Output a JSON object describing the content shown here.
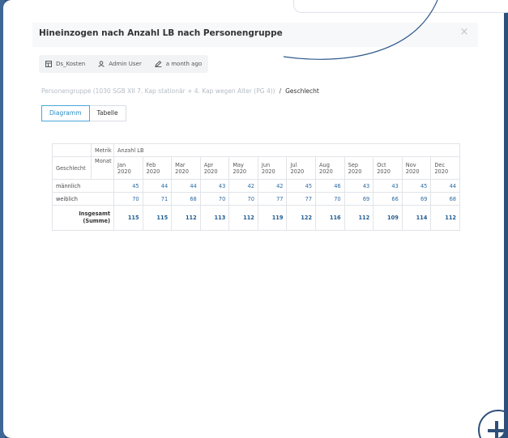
{
  "dialog": {
    "title": "Hineinzogen nach Anzahl LB nach Personengruppe",
    "close_glyph": "×"
  },
  "meta": {
    "dataset": "Ds_Kosten",
    "author": "Admin User",
    "modified": "a month ago",
    "icons": [
      "table-icon",
      "user-icon",
      "pencil-icon"
    ]
  },
  "breadcrumb": {
    "filter": "Personengruppe (1030 SGB XII 7. Kap stationär + 4. Kap wegen Alter (PG 4))",
    "separator": "/",
    "current": "Geschlecht"
  },
  "tabs": [
    {
      "label": "Diagramm",
      "active": true
    },
    {
      "label": "Tabelle",
      "active": false
    }
  ],
  "table": {
    "metric_label": "Metrik",
    "metric_value": "Anzahl LB",
    "month_label": "Monat",
    "row_dim_label": "Geschlecht",
    "months": [
      [
        "Jan",
        "2020"
      ],
      [
        "Feb",
        "2020"
      ],
      [
        "Mar",
        "2020"
      ],
      [
        "Apr",
        "2020"
      ],
      [
        "May",
        "2020"
      ],
      [
        "Jun",
        "2020"
      ],
      [
        "Jul",
        "2020"
      ],
      [
        "Aug",
        "2020"
      ],
      [
        "Sep",
        "2020"
      ],
      [
        "Oct",
        "2020"
      ],
      [
        "Nov",
        "2020"
      ],
      [
        "Dec",
        "2020"
      ]
    ],
    "rows": [
      {
        "label": "männlich",
        "values": [
          "45",
          "44",
          "44",
          "43",
          "42",
          "42",
          "45",
          "46",
          "43",
          "43",
          "45",
          "44"
        ]
      },
      {
        "label": "weiblich",
        "values": [
          "70",
          "71",
          "68",
          "70",
          "70",
          "77",
          "77",
          "70",
          "69",
          "66",
          "69",
          "68"
        ]
      }
    ],
    "total": {
      "label_line1": "Insgesamt",
      "label_line2": "(Summe)",
      "values": [
        "115",
        "115",
        "112",
        "113",
        "112",
        "119",
        "122",
        "116",
        "112",
        "109",
        "114",
        "112"
      ]
    }
  },
  "colors": {
    "accent": "#2a8cc4",
    "value_text": "#2b6aa3",
    "backdrop": "#2d4f7a"
  }
}
